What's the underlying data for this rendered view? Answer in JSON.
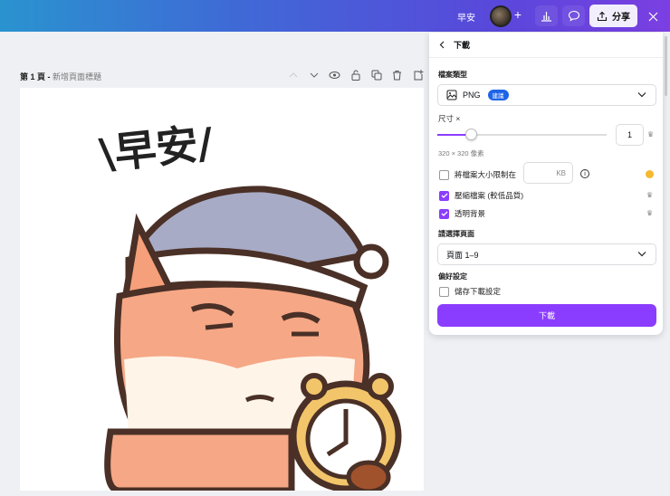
{
  "topbar": {
    "title": "早安",
    "add_label": "+",
    "share_label": "分享"
  },
  "page": {
    "label": "第 1 頁",
    "separator": " - ",
    "title_placeholder": "新增頁面標題"
  },
  "canvas": {
    "sticker_text": "\\早安/"
  },
  "download_panel": {
    "title": "下載",
    "file_type_label": "檔案類型",
    "file_type_value": "PNG",
    "recommended_badge": "建議",
    "size_label": "尺寸 ×",
    "size_multiplier": "1",
    "slider_fraction": 0.2,
    "size_pixels": "320 × 320 像素",
    "limit_size_label": "將檔案大小限制在",
    "limit_size_placeholder": "KB",
    "limit_size_checked": false,
    "compress_label": "壓縮檔案 (較低品質)",
    "compress_checked": true,
    "transparent_label": "透明背景",
    "transparent_checked": true,
    "select_pages_label": "請選擇頁面",
    "pages_value": "頁面 1–9",
    "preferences_label": "偏好設定",
    "save_settings_label": "儲存下載設定",
    "save_settings_checked": false,
    "download_button": "下載"
  },
  "colors": {
    "accent": "#8b3dff",
    "badge": "#1e63e8",
    "header_start": "#2a93cf",
    "header_end": "#7b3fe2"
  }
}
